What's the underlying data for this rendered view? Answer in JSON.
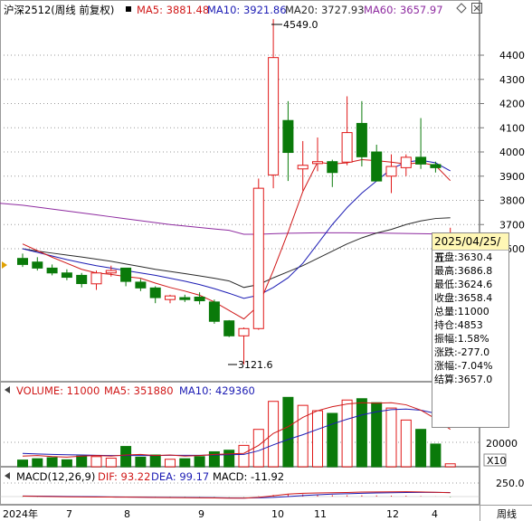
{
  "header": {
    "instrument": "沪深2512(周线 前复权)",
    "ma_labels": [
      {
        "text": "MA5: 3881.48",
        "color": "#d01818"
      },
      {
        "text": "MA10: 3921.86",
        "color": "#1c1cb4"
      },
      {
        "text": "MA20: 3727.93",
        "color": "#2a2a2a"
      },
      {
        "text": "MA60: 3657.97",
        "color": "#8e2ba0"
      }
    ],
    "controls": [
      "diamond-icon",
      "close-icon"
    ]
  },
  "volume_header": {
    "label": "VOLUME: 11000",
    "ma5": "MA5: 351880",
    "ma10": "MA10: 429360",
    "scale_label": "20000",
    "multiplier": "X10"
  },
  "macd_header": {
    "label": "MACD(12,26,9)",
    "dif": "DIF: 93.22",
    "dea": "DEA: 99.17",
    "macd": "MACD: -11.92",
    "scale_label": "250.0"
  },
  "x_axis": {
    "labels": [
      "2024年",
      "7",
      "8",
      "9",
      "10",
      "11",
      "12",
      "4"
    ],
    "period": "周线"
  },
  "annotations": {
    "high": "4549.0",
    "low": "3121.6"
  },
  "info_box": {
    "date": "2025/04/25/五",
    "rows": [
      "开盘:3630.4",
      "最高:3686.8",
      "最低:3624.6",
      "收盘:3658.4",
      "总量:11000",
      "持仓:4853",
      "振幅:1.58%",
      "涨跌:-277.0",
      "涨幅:-7.04%",
      "结算:3657.0"
    ]
  },
  "colors": {
    "up": "#e01818",
    "down": "#0a7a0a",
    "ma5": "#d01818",
    "ma10": "#1c1cb4",
    "ma20": "#2a2a2a",
    "ma60": "#8e2ba0",
    "grid": "#9a9a9a",
    "info_bg": "#fff7b5"
  },
  "chart_data": {
    "type": "candlestick",
    "y_ticks": [
      3600,
      3700,
      3800,
      3900,
      4000,
      4100,
      4200,
      4300,
      4400
    ],
    "candles": [
      {
        "o": 3560,
        "h": 3580,
        "l": 3525,
        "c": 3535,
        "v": 25000
      },
      {
        "o": 3545,
        "h": 3565,
        "l": 3510,
        "c": 3520,
        "v": 30000
      },
      {
        "o": 3520,
        "h": 3535,
        "l": 3490,
        "c": 3500,
        "v": 34000
      },
      {
        "o": 3500,
        "h": 3515,
        "l": 3470,
        "c": 3482,
        "v": 26000
      },
      {
        "o": 3490,
        "h": 3500,
        "l": 3440,
        "c": 3456,
        "v": 40000
      },
      {
        "o": 3455,
        "h": 3510,
        "l": 3430,
        "c": 3500,
        "v": 38000
      },
      {
        "o": 3500,
        "h": 3530,
        "l": 3485,
        "c": 3510,
        "v": 32000
      },
      {
        "o": 3520,
        "h": 3520,
        "l": 3445,
        "c": 3465,
        "v": 76000
      },
      {
        "o": 3462,
        "h": 3475,
        "l": 3425,
        "c": 3438,
        "v": 36000
      },
      {
        "o": 3438,
        "h": 3445,
        "l": 3375,
        "c": 3398,
        "v": 44000
      },
      {
        "o": 3390,
        "h": 3410,
        "l": 3375,
        "c": 3405,
        "v": 28000
      },
      {
        "o": 3398,
        "h": 3410,
        "l": 3380,
        "c": 3390,
        "v": 30000
      },
      {
        "o": 3400,
        "h": 3420,
        "l": 3370,
        "c": 3385,
        "v": 38000
      },
      {
        "o": 3380,
        "h": 3390,
        "l": 3290,
        "c": 3300,
        "v": 56000
      },
      {
        "o": 3302,
        "h": 3305,
        "l": 3235,
        "c": 3240,
        "v": 62000
      },
      {
        "o": 3240,
        "h": 3275,
        "l": 3122,
        "c": 3270,
        "v": 80000
      },
      {
        "o": 3270,
        "h": 3890,
        "l": 3265,
        "c": 3850,
        "v": 140000
      },
      {
        "o": 3905,
        "h": 4549,
        "l": 3850,
        "c": 4390,
        "v": 245000
      },
      {
        "o": 4130,
        "h": 4210,
        "l": 3880,
        "c": 3998,
        "v": 260000
      },
      {
        "o": 3930,
        "h": 4045,
        "l": 3840,
        "c": 3945,
        "v": 230000
      },
      {
        "o": 3952,
        "h": 4060,
        "l": 3920,
        "c": 3960,
        "v": 210000
      },
      {
        "o": 3960,
        "h": 3968,
        "l": 3855,
        "c": 3915,
        "v": 200000
      },
      {
        "o": 3958,
        "h": 4230,
        "l": 3945,
        "c": 4080,
        "v": 250000
      },
      {
        "o": 4118,
        "h": 4210,
        "l": 3940,
        "c": 3980,
        "v": 255000
      },
      {
        "o": 4000,
        "h": 4030,
        "l": 3880,
        "c": 3880,
        "v": 240000
      },
      {
        "o": 3900,
        "h": 3990,
        "l": 3830,
        "c": 3940,
        "v": 220000
      },
      {
        "o": 3935,
        "h": 3990,
        "l": 3900,
        "c": 3978,
        "v": 175000
      },
      {
        "o": 3978,
        "h": 4140,
        "l": 3930,
        "c": 3950,
        "v": 140000
      },
      {
        "o": 3948,
        "h": 3960,
        "l": 3915,
        "c": 3935,
        "v": 85000
      },
      {
        "o": 3630.4,
        "h": 3686.8,
        "l": 3624.6,
        "c": 3658.4,
        "v": 11000
      }
    ],
    "ma5": [
      3620,
      3592,
      3565,
      3540,
      3515,
      3500,
      3494,
      3485,
      3478,
      3458,
      3440,
      3425,
      3408,
      3380,
      3345,
      3310,
      3365,
      3510,
      3668,
      3836,
      3958,
      3950,
      3955,
      3968,
      3964,
      3958,
      3950,
      3956,
      3944,
      3881.48
    ],
    "ma10": [
      3600,
      3585,
      3570,
      3555,
      3542,
      3530,
      3520,
      3510,
      3500,
      3490,
      3478,
      3466,
      3452,
      3435,
      3416,
      3395,
      3408,
      3440,
      3480,
      3540,
      3620,
      3700,
      3770,
      3830,
      3880,
      3930,
      3958,
      3966,
      3955,
      3921.86
    ],
    "ma20": [
      3600,
      3590,
      3582,
      3574,
      3566,
      3557,
      3548,
      3537,
      3526,
      3515,
      3506,
      3497,
      3488,
      3478,
      3467,
      3440,
      3452,
      3480,
      3505,
      3530,
      3560,
      3590,
      3620,
      3645,
      3665,
      3680,
      3700,
      3715,
      3725,
      3727.93
    ],
    "ma60": [
      3780,
      3772,
      3764,
      3756,
      3748,
      3740,
      3732,
      3724,
      3716,
      3708,
      3700,
      3694,
      3688,
      3682,
      3676,
      3660,
      3660,
      3662,
      3664,
      3665,
      3666,
      3666,
      3666,
      3665,
      3665,
      3664,
      3663,
      3662,
      3661,
      3657.97
    ],
    "vol_ma5": [
      40000,
      42000,
      38000,
      36000,
      40000,
      42000,
      40000,
      44000,
      46000,
      42000,
      44000,
      40000,
      42000,
      46000,
      48000,
      50000,
      80000,
      125000,
      150000,
      185000,
      210000,
      225000,
      235000,
      240000,
      238000,
      240000,
      232000,
      212000,
      180000,
      140000
    ],
    "vol_ma10": [
      50000,
      48000,
      46000,
      45000,
      44000,
      43000,
      42000,
      42000,
      42000,
      42000,
      43000,
      43000,
      43000,
      44000,
      45000,
      46000,
      60000,
      82000,
      102000,
      120000,
      140000,
      160000,
      178000,
      194000,
      206000,
      214000,
      216000,
      212000,
      200000,
      180000
    ],
    "dif": [
      10,
      5,
      0,
      -5,
      -8,
      -10,
      -12,
      -15,
      -18,
      -22,
      -25,
      -27,
      -30,
      -34,
      -38,
      -40,
      -20,
      20,
      60,
      80,
      90,
      95,
      100,
      110,
      115,
      118,
      120,
      115,
      105,
      93.22
    ],
    "dea": [
      15,
      12,
      8,
      3,
      -1,
      -4,
      -7,
      -10,
      -13,
      -17,
      -20,
      -22,
      -25,
      -28,
      -32,
      -35,
      -30,
      -20,
      0,
      25,
      45,
      60,
      70,
      80,
      88,
      95,
      100,
      103,
      102,
      99.17
    ],
    "macd": [
      -5,
      -7,
      -8,
      -8,
      -7,
      -6,
      -5,
      -5,
      -5,
      -5,
      -5,
      -5,
      -5,
      -6,
      -6,
      -5,
      10,
      40,
      60,
      55,
      45,
      35,
      30,
      30,
      27,
      23,
      20,
      12,
      3,
      -11.92
    ]
  }
}
